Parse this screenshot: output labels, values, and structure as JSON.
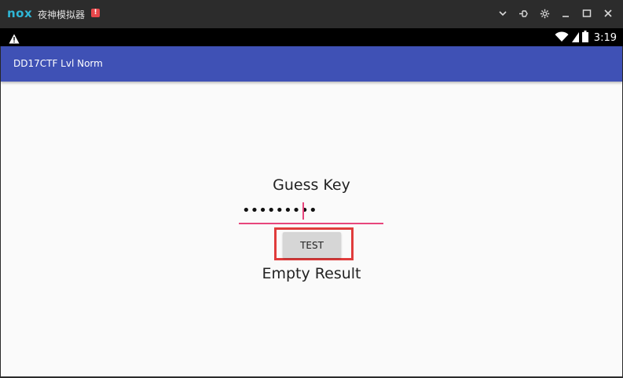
{
  "window": {
    "logo": "nox",
    "title": "夜神模拟器",
    "alert_badge": "!",
    "controls": [
      "chevron-down-icon",
      "pin-icon",
      "settings-icon",
      "minimize-icon",
      "maximize-icon",
      "close-icon"
    ]
  },
  "statusbar": {
    "time": "3:19",
    "icons": [
      "warning-icon",
      "wifi-icon",
      "signal-icon",
      "battery-icon"
    ]
  },
  "appbar": {
    "title": "DD17CTF Lvl Norm",
    "color": "#3f51b5"
  },
  "main": {
    "guess_label": "Guess Key",
    "key_masked": "•••••••••",
    "key_length": 9,
    "test_button_label": "TEST",
    "result_label": "Empty Result",
    "accent_color": "#e8457c",
    "highlight_color": "#e03c3c"
  }
}
